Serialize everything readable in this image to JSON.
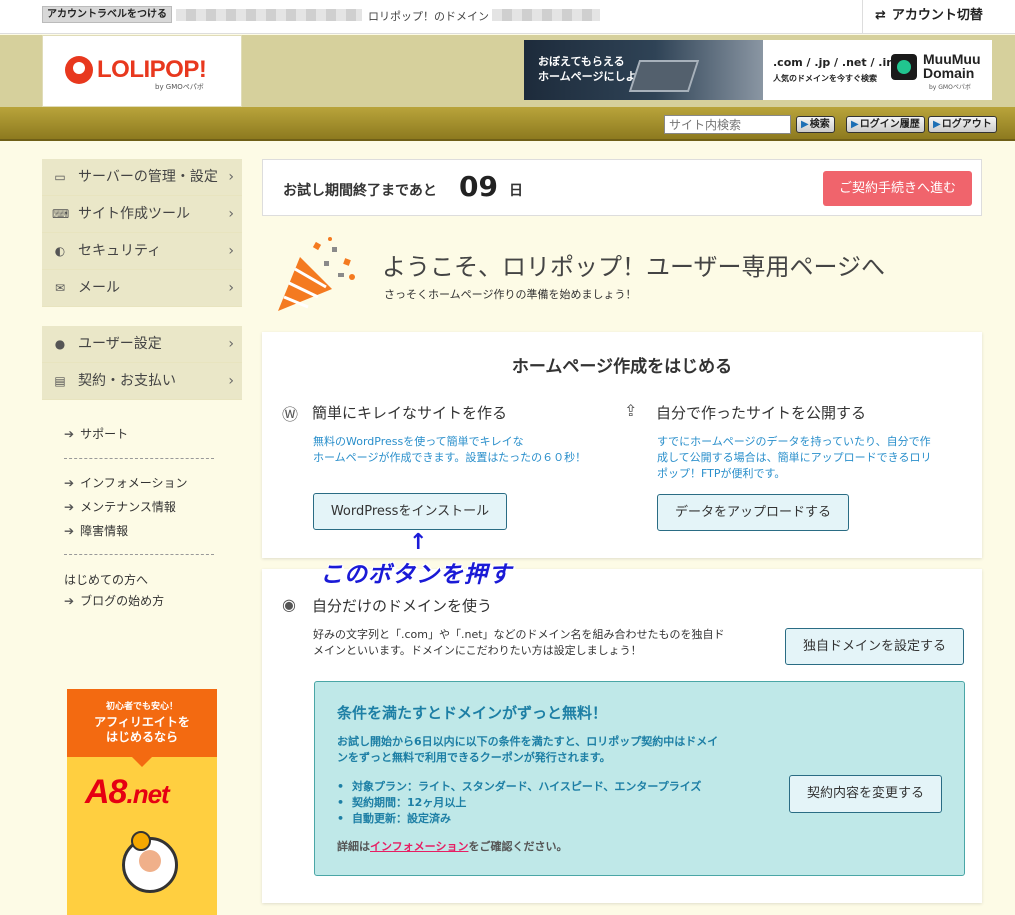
{
  "topbar": {
    "account_label_button": "アカウントラベルをつける",
    "domain_label": "ロリポップ！のドメイン",
    "account_switch": "アカウント切替"
  },
  "header": {
    "logo_text": "LOLIPOP!",
    "logo_sub": "by GMOペパボ",
    "banner1_text": "おぼえてもらえる\nホームページにしよう。",
    "banner2_line1": ".com / .jp / .net / .info",
    "banner2_line2": "人気のドメインを今すぐ検索",
    "banner2_brand": "MuuMuu\nDomain",
    "banner2_sub": "by GMOペパボ"
  },
  "goldbar": {
    "search_placeholder": "サイト内検索",
    "search_button": "検索",
    "login_history_button": "ログイン履歴",
    "logout_button": "ログアウト"
  },
  "sidebar": {
    "group1": [
      {
        "label": "サーバーの管理・設定",
        "icon": "server-icon"
      },
      {
        "label": "サイト作成ツール",
        "icon": "laptop-icon"
      },
      {
        "label": "セキュリティ",
        "icon": "shield-icon"
      },
      {
        "label": "メール",
        "icon": "mail-icon"
      }
    ],
    "group2": [
      {
        "label": "ユーザー設定",
        "icon": "user-icon"
      },
      {
        "label": "契約・お支払い",
        "icon": "card-icon"
      }
    ],
    "support": "サポート",
    "info": "インフォメーション",
    "maintenance": "メンテナンス情報",
    "trouble": "障害情報",
    "first_time": "はじめての方へ",
    "blog_start": "ブログの始め方",
    "a8_small": "初心者でも安心！",
    "a8_big": "アフィリエイトを\nはじめるなら",
    "a8_logo_a": "A8",
    "a8_logo_b": ".net"
  },
  "main": {
    "trial_label": "お試し期間終了まであと",
    "trial_days": "09",
    "trial_unit": "日",
    "contract_button": "ご契約手続きへ進む",
    "welcome_title": "ようこそ、ロリポップ！ユーザー専用ページへ",
    "welcome_sub": "さっそくホームページ作りの準備を始めましょう！",
    "card1_title": "ホームページ作成をはじめる",
    "wp_title": "簡単にキレイなサイトを作る",
    "wp_desc": "無料のWordPressを使って簡単でキレイな\nホームページが作成できます。設置はたったの６０秒！",
    "wp_button": "WordPressをインストール",
    "upload_title": "自分で作ったサイトを公開する",
    "upload_desc": "すでにホームページのデータを持っていたり、自分で作\n成して公開する場合は、簡単にアップロードできるロリ\nポップ！FTPが便利です。",
    "upload_button": "データをアップロードする",
    "domain_title": "自分だけのドメインを使う",
    "domain_desc": "好みの文字列と「.com」や「.net」などのドメイン名を組み合わせたものを独自ド\nメインといいます。ドメインにこだわりたい方は設定しましょう！",
    "domain_button": "独自ドメインを設定する",
    "promo_title": "条件を満たすとドメインがずっと無料！",
    "promo_body": "お試し開始から6日以内に以下の条件を満たすと、ロリポップ契約中はドメイ\nンをずっと無料で利用できるクーポンが発行されます。",
    "promo_items": [
      "対象プラン：ライト、スタンダード、ハイスピード、エンタープライズ",
      "契約期間：12ヶ月以上",
      "自動更新：設定済み"
    ],
    "promo_note_pre": "詳細は",
    "promo_note_link": "インフォメーション",
    "promo_note_post": "をご確認ください。",
    "promo_button": "契約内容を変更する"
  },
  "annotation": {
    "arrow": "↑",
    "text": "このボタンを押す"
  },
  "colors": {
    "accent_red": "#e8381e",
    "gold_bar": "#a8942c",
    "contract_pink": "#f0646c",
    "link_blue": "#2a8fcb",
    "promo_teal": "#bfe8e8"
  }
}
